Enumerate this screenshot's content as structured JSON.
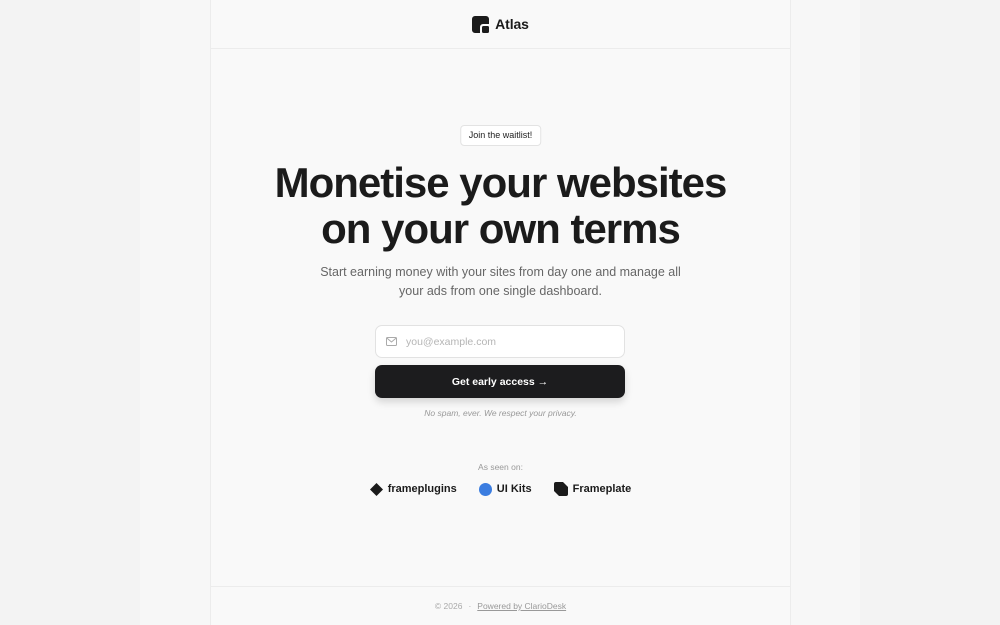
{
  "header": {
    "brand_name": "Atlas",
    "logo_icon": "atlas-logo-icon"
  },
  "hero": {
    "badge": "Join the waitlist!",
    "headline_line1": "Monetise your websites",
    "headline_line2": "on your own terms",
    "subtext_line1": "Start earning money with your sites from day one and manage all",
    "subtext_line2": "your ads from one single dashboard."
  },
  "form": {
    "email_placeholder": "you@example.com",
    "email_value": "",
    "email_icon": "mail-icon",
    "cta_label": "Get early access →",
    "privacy_note": "No spam, ever. We respect your privacy."
  },
  "social_proof": {
    "label": "As seen on:",
    "partners": [
      {
        "name": "frameplugins",
        "icon": "diamond-icon"
      },
      {
        "name": "UI Kits",
        "icon": "blue-circle-icon"
      },
      {
        "name": "Frameplate",
        "icon": "frameplate-logo-icon"
      }
    ]
  },
  "footer": {
    "copyright": "© 2026",
    "separator": "·",
    "powered_by": "Powered by ClarioDesk"
  },
  "colors": {
    "accent_dark": "#1c1c1e",
    "partner_blue": "#3b7de0",
    "background": "#f9f9f9"
  }
}
